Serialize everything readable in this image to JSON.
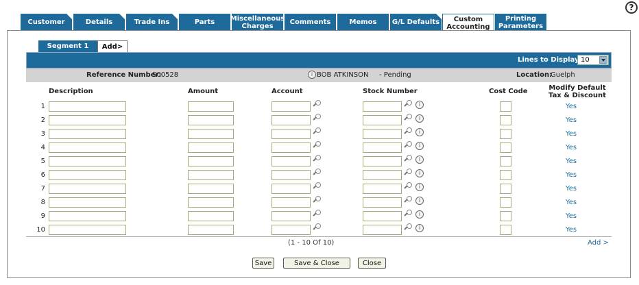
{
  "help": {
    "label": "?"
  },
  "tabs": [
    {
      "label": "Customer"
    },
    {
      "label": "Details"
    },
    {
      "label": "Trade Ins"
    },
    {
      "label": "Parts"
    },
    {
      "label": "Miscellaneous Charges"
    },
    {
      "label": "Comments"
    },
    {
      "label": "Memos"
    },
    {
      "label": "G/L Defaults"
    },
    {
      "label": "Custom Accounting"
    },
    {
      "label": "Printing Parameters"
    }
  ],
  "segments": {
    "active": "Segment 1",
    "add": "Add>"
  },
  "lines_to_display": {
    "label": "Lines to Display:",
    "value": "10"
  },
  "info": {
    "reference_label": "Reference Number:",
    "reference_value": "S00528",
    "customer_icon": "i",
    "customer_name": "BOB ATKINSON",
    "customer_status": "-  Pending",
    "location_label": "Location:",
    "location_value": "Guelph"
  },
  "columns": {
    "description": "Description",
    "amount": "Amount",
    "account": "Account",
    "stock_number": "Stock Number",
    "cost_code": "Cost Code",
    "modify": "Modify Default Tax & Discount"
  },
  "rows": [
    {
      "num": "1",
      "modify": "Yes"
    },
    {
      "num": "2",
      "modify": "Yes"
    },
    {
      "num": "3",
      "modify": "Yes"
    },
    {
      "num": "4",
      "modify": "Yes"
    },
    {
      "num": "5",
      "modify": "Yes"
    },
    {
      "num": "6",
      "modify": "Yes"
    },
    {
      "num": "7",
      "modify": "Yes"
    },
    {
      "num": "8",
      "modify": "Yes"
    },
    {
      "num": "9",
      "modify": "Yes"
    },
    {
      "num": "10",
      "modify": "Yes"
    }
  ],
  "row_icons": {
    "lookup": "magnifier-icon",
    "info": "info-icon",
    "info_glyph": "i"
  },
  "pager": "(1  -  10  Of  10)",
  "add_link": "Add >",
  "buttons": {
    "save": "Save",
    "save_close": "Save & Close",
    "close": "Close"
  },
  "colors": {
    "accent": "#1e6a9b",
    "info_bar": "#d3d3d3",
    "field_border": "#a8a878"
  }
}
